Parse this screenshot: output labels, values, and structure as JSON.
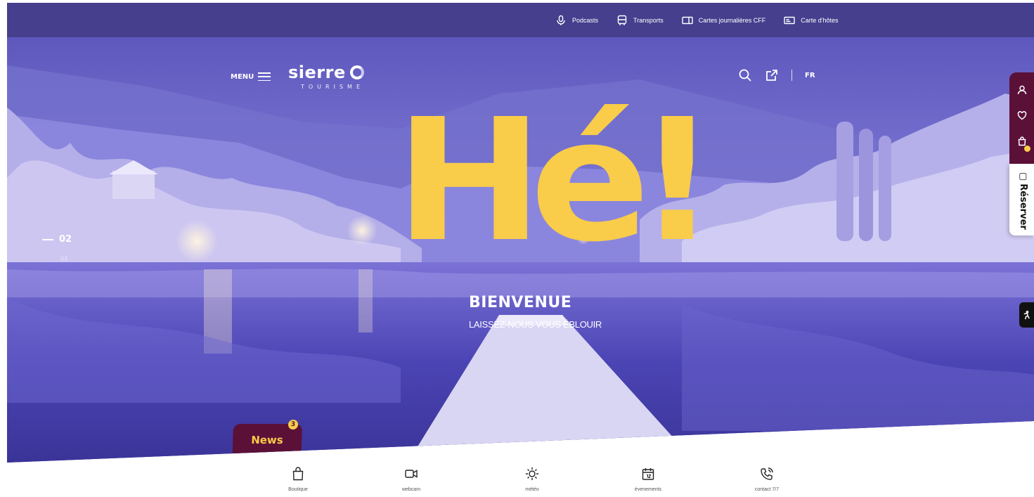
{
  "topbar": {
    "links": [
      {
        "label": "Podcasts",
        "icon": "microphone-icon"
      },
      {
        "label": "Transports",
        "icon": "bus-icon"
      },
      {
        "label": "Cartes journalières CFF",
        "icon": "ticket-icon"
      },
      {
        "label": "Carte d'hôtes",
        "icon": "card-icon"
      }
    ]
  },
  "header": {
    "menu_label": "MENU",
    "logo_word": "sierre",
    "logo_sub": "TOURISME",
    "lang": "FR"
  },
  "hero": {
    "headline": "Hé!",
    "title": "Bienvenue",
    "tagline": "Laissez-nous vous éblouir",
    "slide_current": "02",
    "slide_next": "03"
  },
  "news": {
    "label": "News",
    "count": "3"
  },
  "sidebar": {
    "reserve_label": "Réserver"
  },
  "quick_links": [
    {
      "label": "Boutique",
      "icon": "shopping-bag-icon"
    },
    {
      "label": "webcam",
      "icon": "video-camera-icon"
    },
    {
      "label": "météo",
      "icon": "sun-icon"
    },
    {
      "label": "évenements",
      "icon": "calendar-icon"
    },
    {
      "label": "contact 7/7",
      "icon": "phone-icon"
    }
  ],
  "colors": {
    "topbar": "#463f8e",
    "accent_yellow": "#f9cc4a",
    "sidebar": "#5b1038"
  }
}
